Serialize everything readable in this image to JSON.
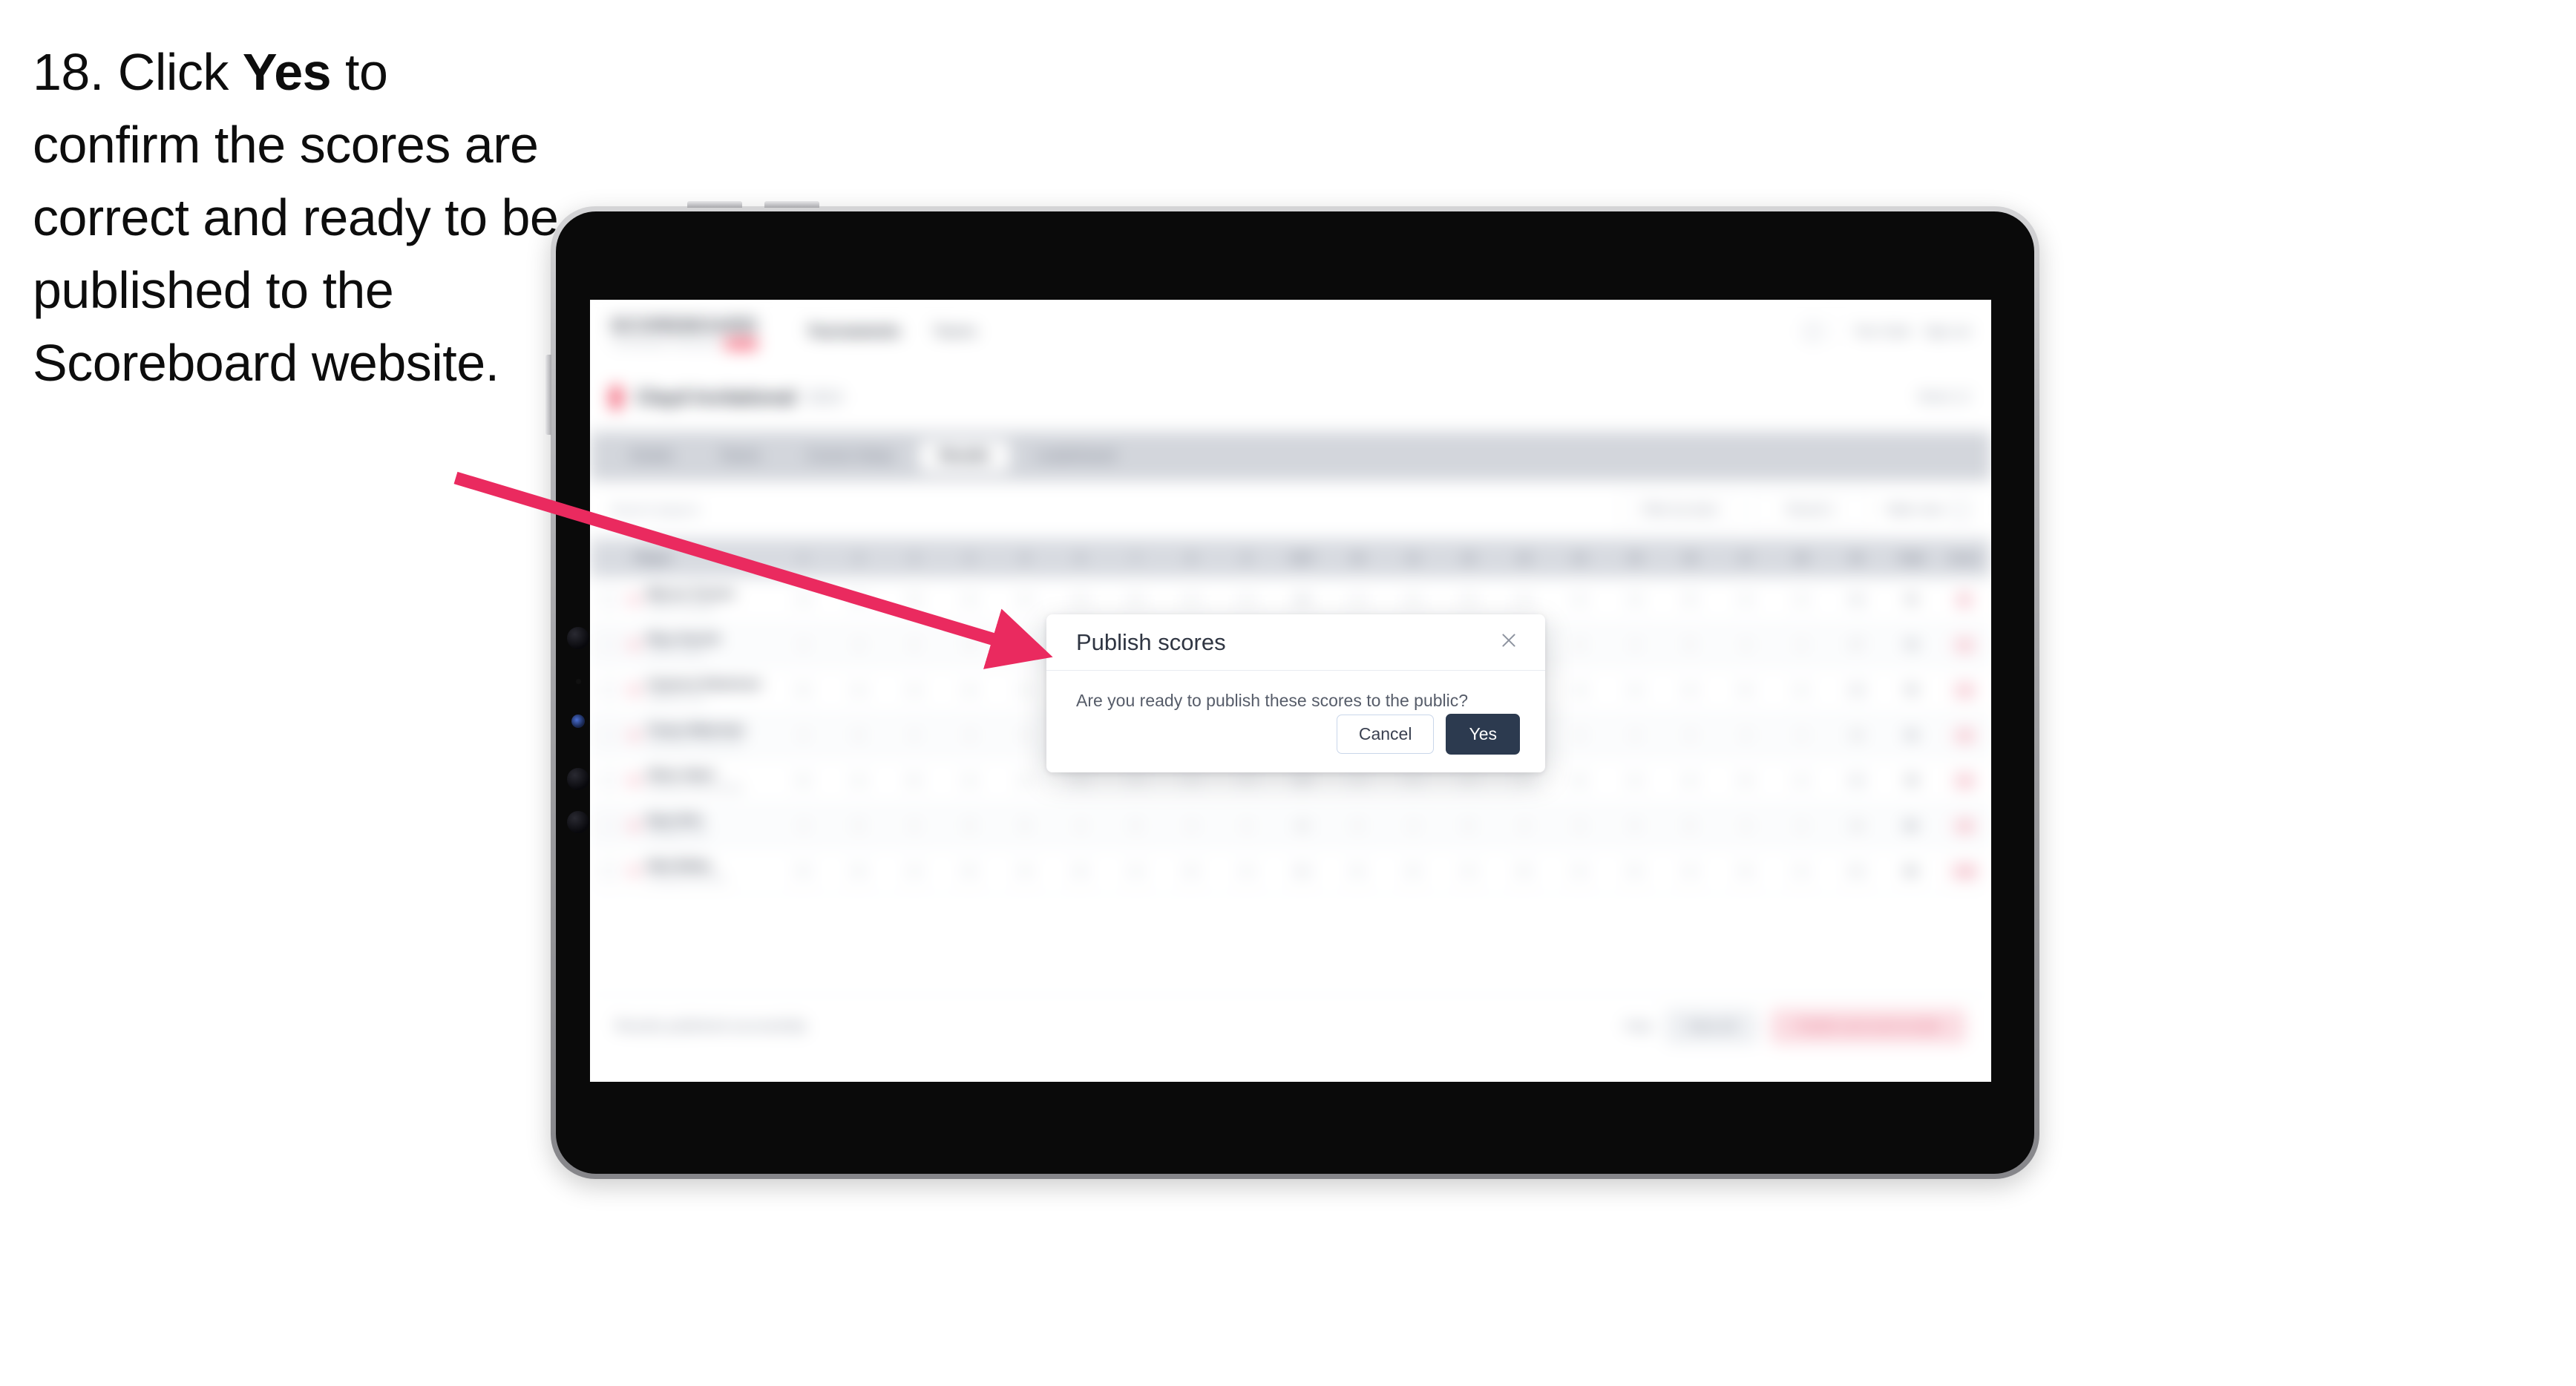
{
  "instruction": {
    "step_number": "18.",
    "text_before": " Click ",
    "emphasis": "Yes",
    "text_after": " to confirm the scores are correct and ready to be published to the Scoreboard website."
  },
  "colors": {
    "arrow": "#ea2a5f",
    "primary_button": "#2c3a4f",
    "accent_pink": "#f0425c",
    "device_frame": "#0a0a0a",
    "device_edge": "#b8b8bb"
  },
  "dialog": {
    "title": "Publish scores",
    "close_icon": "close-icon",
    "body": "Are you ready to publish these scores to the public?",
    "cancel_label": "Cancel",
    "confirm_label": "Yes"
  },
  "app": {
    "brand": {
      "name": "SCOREBOARD",
      "subtitle": "TOURNAMENT MANAGER",
      "pill": "BETA"
    },
    "nav_links": [
      {
        "label": "Tournaments",
        "active": true
      },
      {
        "label": "Teams",
        "active": false
      }
    ],
    "nav_right": {
      "bell_icon": "bell-icon",
      "user_name": "Tom Clark",
      "signout_label": "Sign out"
    },
    "subheader": {
      "flag_icon": "flag-icon",
      "tournament": "Clayd Invitational",
      "date": "2024",
      "right_label": "Week 12"
    },
    "tabs": [
      {
        "label": "Details",
        "active": false
      },
      {
        "label": "Teams",
        "active": false
      },
      {
        "label": "Course Setup",
        "active": false
      },
      {
        "label": "Results",
        "active": true
      },
      {
        "label": "Leaderboard",
        "active": false
      }
    ],
    "filters": {
      "search_placeholder": "Search players",
      "team_select": "Filter by team",
      "round_select": "Round 1",
      "sort_label": "Table view",
      "gear_icon": "gear-icon"
    },
    "table": {
      "columns_leading": [
        "Player"
      ],
      "hole_columns": [
        "1",
        "2",
        "3",
        "4",
        "5",
        "6",
        "7",
        "8",
        "9",
        "OUT",
        "10",
        "11",
        "12",
        "13",
        "14",
        "15",
        "16",
        "17",
        "18",
        "IN"
      ],
      "columns_trailing": [
        "Total",
        "Score"
      ],
      "rows": [
        {
          "rank": "1",
          "name": "Marcus Turners",
          "club": "Eastern Fairways",
          "scores": [
            "4",
            "5",
            "3",
            "4",
            "4",
            "3",
            "5",
            "4",
            "4",
            "36",
            "4",
            "5",
            "3",
            "4",
            "4",
            "3",
            "5",
            "4",
            "4",
            "36"
          ],
          "total": "72",
          "score": "E"
        },
        {
          "rank": "2",
          "name": "Rhys Parrish",
          "club": "Cavern Hollow",
          "scores": [
            "4",
            "4",
            "4",
            "5",
            "3",
            "4",
            "4",
            "4",
            "4",
            "36",
            "5",
            "4",
            "4",
            "4",
            "3",
            "4",
            "5",
            "4",
            "4",
            "37"
          ],
          "total": "73",
          "score": "+1"
        },
        {
          "rank": "3",
          "name": "Cameron Robertson",
          "club": "Highland Links",
          "scores": [
            "5",
            "4",
            "4",
            "4",
            "4",
            "4",
            "4",
            "5",
            "3",
            "37",
            "4",
            "4",
            "5",
            "4",
            "4",
            "4",
            "4",
            "5",
            "4",
            "38"
          ],
          "total": "75",
          "score": "+3"
        },
        {
          "rank": "4",
          "name": "Tomas Waterman",
          "club": "Greenfield Country Club",
          "scores": [
            "4",
            "5",
            "4",
            "4",
            "5",
            "4",
            "4",
            "4",
            "4",
            "38",
            "5",
            "4",
            "4",
            "5",
            "4",
            "4",
            "4",
            "4",
            "4",
            "38"
          ],
          "total": "76",
          "score": "+4"
        },
        {
          "rank": "5",
          "name": "Oliver Abert",
          "club": "Riverbend Golf and Spa",
          "scores": [
            "5",
            "4",
            "5",
            "4",
            "4",
            "5",
            "4",
            "4",
            "4",
            "39",
            "4",
            "5",
            "4",
            "4",
            "5",
            "4",
            "4",
            "5",
            "4",
            "39"
          ],
          "total": "78",
          "score": "+6"
        },
        {
          "rank": "6",
          "name": "Ryan Brin",
          "club": "Westgate Links",
          "scores": [
            "4",
            "5",
            "4",
            "5",
            "5",
            "4",
            "5",
            "4",
            "4",
            "40",
            "5",
            "4",
            "5",
            "4",
            "4",
            "5",
            "5",
            "4",
            "4",
            "40"
          ],
          "total": "80",
          "score": "+8"
        },
        {
          "rank": "7",
          "name": "Nate Bailey",
          "club": "Northfield Golf Club",
          "scores": [
            "5",
            "5",
            "4",
            "5",
            "4",
            "5",
            "4",
            "5",
            "4",
            "41",
            "5",
            "5",
            "4",
            "5",
            "4",
            "5",
            "4",
            "5",
            "4",
            "41"
          ],
          "total": "82",
          "score": "+10"
        }
      ]
    },
    "bottombar": {
      "status": "Results published successfully",
      "link": "Help",
      "secondary_button": "Save all",
      "primary_button": "Publish and send emails"
    }
  }
}
